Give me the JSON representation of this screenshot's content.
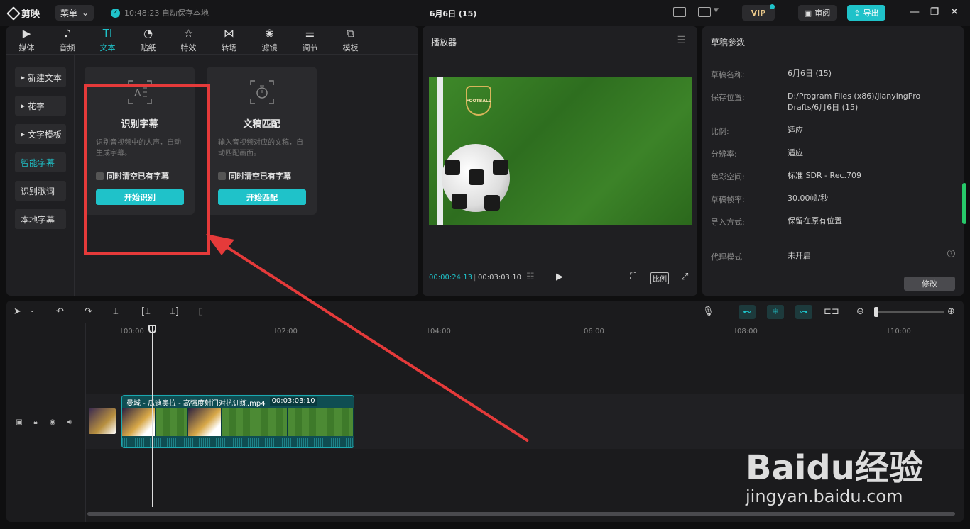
{
  "titlebar": {
    "app_name": "剪映",
    "menu_label": "菜单",
    "save_status": "10:48:23 自动保存本地",
    "project_title": "6月6日 (15)",
    "vip_label": "VIP",
    "review_label": "审阅",
    "export_label": "导出"
  },
  "media": {
    "tabs": [
      {
        "label": "媒体",
        "icon": "media-icon"
      },
      {
        "label": "音频",
        "icon": "audio-icon"
      },
      {
        "label": "文本",
        "icon": "text-icon"
      },
      {
        "label": "贴纸",
        "icon": "sticker-icon"
      },
      {
        "label": "特效",
        "icon": "effect-icon"
      },
      {
        "label": "转场",
        "icon": "transition-icon"
      },
      {
        "label": "滤镜",
        "icon": "filter-icon"
      },
      {
        "label": "调节",
        "icon": "adjust-icon"
      },
      {
        "label": "模板",
        "icon": "template-icon"
      }
    ],
    "active_tab": "文本",
    "sidebar": [
      "新建文本",
      "花字",
      "文字模板",
      "智能字幕",
      "识别歌词",
      "本地字幕"
    ],
    "sidebar_active": "智能字幕",
    "cards": [
      {
        "title": "识别字幕",
        "desc": "识别音视频中的人声，自动生成字幕。",
        "checkbox": "同时清空已有字幕",
        "button": "开始识别"
      },
      {
        "title": "文稿匹配",
        "desc": "输入音视频对应的文稿，自动匹配画面。",
        "checkbox": "同时清空已有字幕",
        "button": "开始匹配"
      }
    ]
  },
  "player": {
    "title": "播放器",
    "current_time": "00:00:24:13",
    "total_time": "00:03:03:10",
    "ratio_label": "比例",
    "video_badge": "FOOTBALL"
  },
  "draft": {
    "title": "草稿参数",
    "rows": [
      {
        "label": "草稿名称:",
        "value": "6月6日 (15)"
      },
      {
        "label": "保存位置:",
        "value": "D:/Program Files (x86)/JianyingPro Drafts/6月6日 (15)"
      },
      {
        "label": "比例:",
        "value": "适应"
      },
      {
        "label": "分辨率:",
        "value": "适应"
      },
      {
        "label": "色彩空间:",
        "value": "标准 SDR - Rec.709"
      },
      {
        "label": "草稿帧率:",
        "value": "30.00帧/秒"
      },
      {
        "label": "导入方式:",
        "value": "保留在原有位置"
      },
      {
        "label": "代理模式",
        "value": "未开启"
      }
    ],
    "modify_label": "修改"
  },
  "timeline": {
    "ruler": [
      "00:00",
      "02:00",
      "04:00",
      "06:00",
      "08:00",
      "10:00"
    ],
    "clip_name": "曼城 - 瓜迪奥拉 - 高强度射门对抗训练.mp4",
    "clip_duration": "00:03:03:10"
  },
  "watermark": {
    "logo": "Baidu经验",
    "url": "jingyan.baidu.com"
  },
  "colors": {
    "accent": "#1fc2c9",
    "highlight": "#e53a3a",
    "panel": "#1f1f22"
  }
}
